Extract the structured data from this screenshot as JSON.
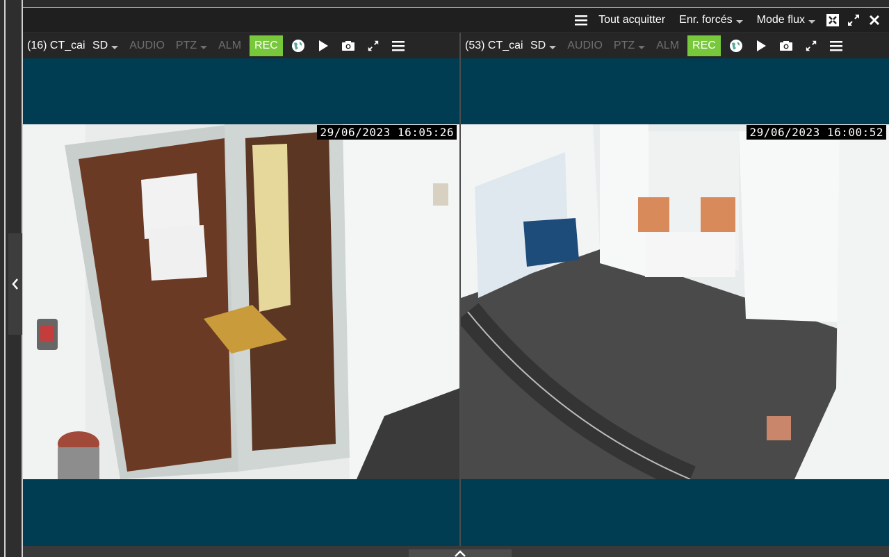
{
  "toolbar": {
    "ack_all_label": "Tout acquitter",
    "forced_rec_label": "Enr. forcés",
    "stream_mode_label": "Mode flux"
  },
  "tiles": [
    {
      "camera_name": "(16) CT_cai",
      "quality": "SD",
      "audio_label": "AUDIO",
      "ptz_label": "PTZ",
      "alarm_label": "ALM",
      "rec_label": "REC",
      "timestamp": "29/06/2023 16:05:26"
    },
    {
      "camera_name": "(53) CT_cai",
      "quality": "SD",
      "audio_label": "AUDIO",
      "ptz_label": "PTZ",
      "alarm_label": "ALM",
      "rec_label": "REC",
      "timestamp": "29/06/2023 16:00:52"
    }
  ],
  "colors": {
    "video_background": "#003c52",
    "rec_active": "#78c83c",
    "disabled_text": "#6f6f6f",
    "toolbar_bg": "#1f1f1f"
  },
  "icons": [
    "menu-icon",
    "caret-down-icon",
    "layout-icon",
    "expand-icon",
    "close-icon",
    "play-icon",
    "camera-icon",
    "globe-icon",
    "chevron-left-icon",
    "chevron-up-icon"
  ]
}
